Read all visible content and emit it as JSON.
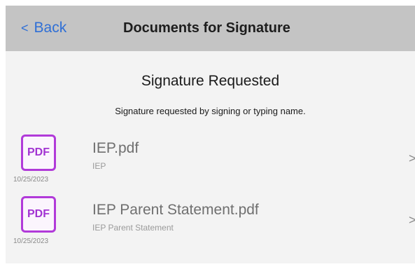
{
  "header": {
    "back_label": "Back",
    "back_chevron": "<",
    "title": "Documents for Signature"
  },
  "section": {
    "title": "Signature Requested",
    "subtitle": "Signature requested by signing or typing name."
  },
  "documents": [
    {
      "icon_label": "PDF",
      "date": "10/25/2023",
      "name": "IEP.pdf",
      "description": "IEP",
      "chevron": ">"
    },
    {
      "icon_label": "PDF",
      "date": "10/25/2023",
      "name": "IEP Parent Statement.pdf",
      "description": "IEP Parent Statement",
      "chevron": ">"
    }
  ],
  "colors": {
    "header_bg": "#c4c4c4",
    "back_link": "#2f6fd6",
    "pdf_icon": "#b13ad9",
    "screen_bg": "#f3f3f3"
  }
}
